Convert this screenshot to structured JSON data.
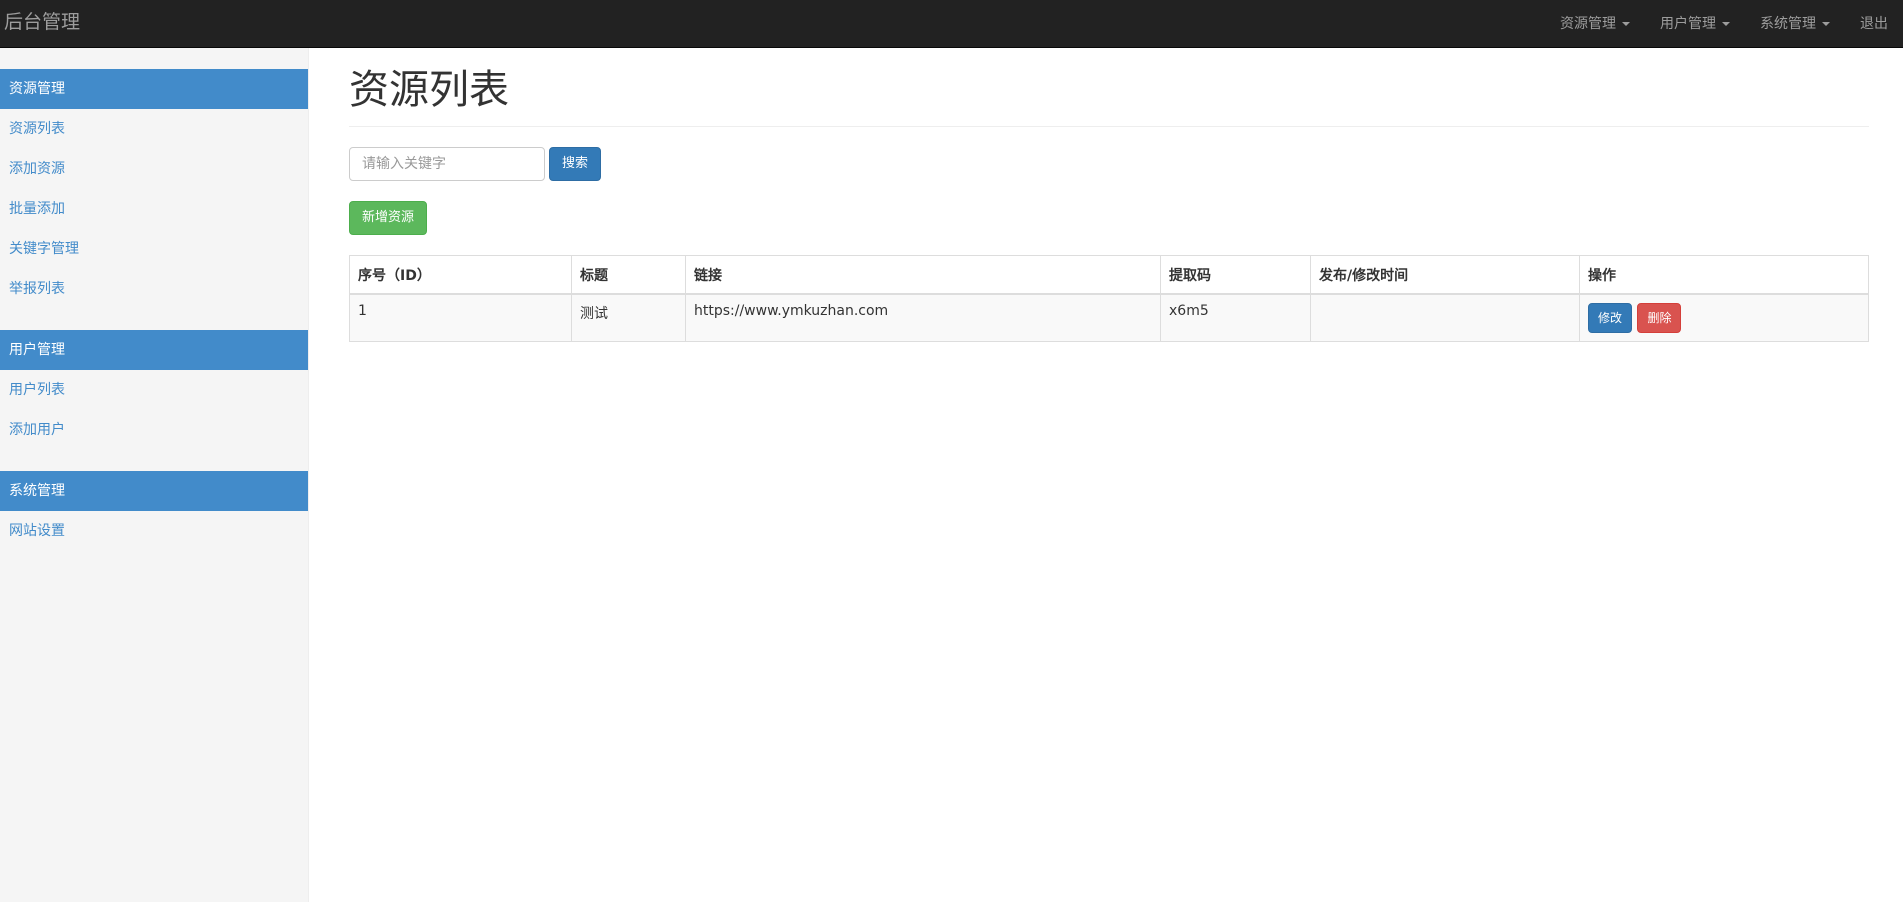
{
  "navbar": {
    "brand": "后台管理",
    "menus": [
      {
        "label": "资源管理",
        "has_caret": true
      },
      {
        "label": "用户管理",
        "has_caret": true
      },
      {
        "label": "系统管理",
        "has_caret": true
      },
      {
        "label": "退出",
        "has_caret": false
      }
    ]
  },
  "sidebar": {
    "groups": [
      {
        "title": "资源管理",
        "items": [
          "资源列表",
          "添加资源",
          "批量添加",
          "关键字管理",
          "举报列表"
        ]
      },
      {
        "title": "用户管理",
        "items": [
          "用户列表",
          "添加用户"
        ]
      },
      {
        "title": "系统管理",
        "items": [
          "网站设置"
        ]
      }
    ]
  },
  "main": {
    "title": "资源列表",
    "search": {
      "placeholder": "请输入关键字",
      "value": "",
      "button": "搜索"
    },
    "add_button": "新增资源",
    "table": {
      "columns": [
        "序号（ID）",
        "标题",
        "链接",
        "提取码",
        "发布/修改时间",
        "操作"
      ],
      "rows": [
        {
          "id": "1",
          "title": "测试",
          "link": "https://www.ymkuzhan.com",
          "code": "x6m5",
          "time": "",
          "edit": "修改",
          "delete": "删除"
        }
      ]
    }
  },
  "colors": {
    "primary": "#428bca",
    "navbar": "#222222",
    "success": "#5cb85c",
    "danger": "#d9534f"
  }
}
